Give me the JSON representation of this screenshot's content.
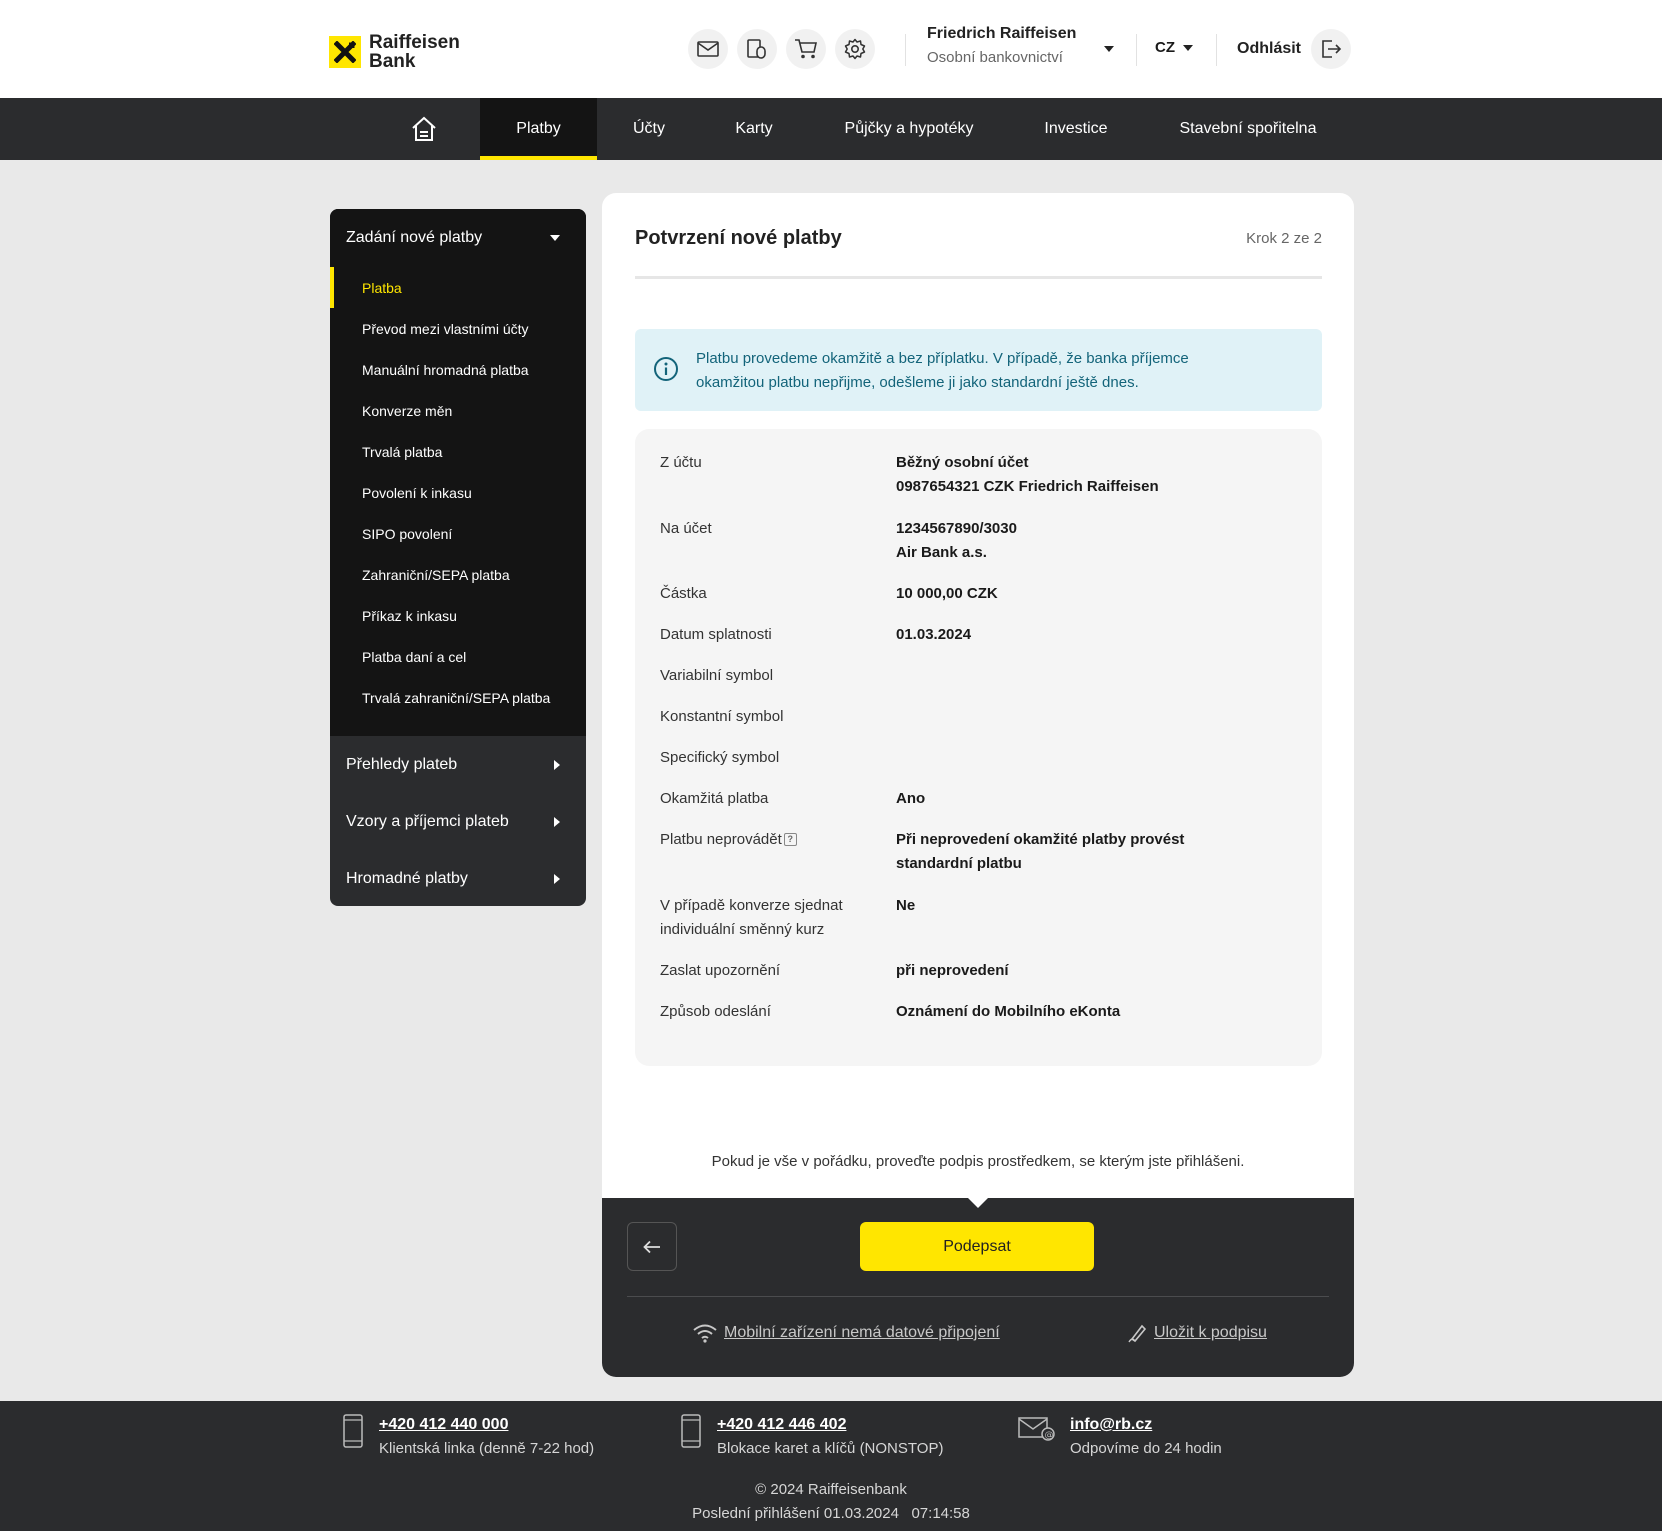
{
  "brand": {
    "logo_line1": "Raiffeisen",
    "logo_line2": "Bank",
    "accent_color": "#ffe600",
    "dark_color": "#2b2c2e"
  },
  "header": {
    "icons": [
      "mail-icon",
      "documents-icon",
      "cart-icon",
      "settings-icon"
    ],
    "user_name": "Friedrich Raiffeisen",
    "user_segment": "Osobní bankovnictví",
    "language": "CZ",
    "logout_label": "Odhlásit"
  },
  "nav": {
    "home_icon": "home-icon",
    "items": [
      "Platby",
      "Účty",
      "Karty",
      "Půjčky a hypotéky",
      "Investice",
      "Stavební spořitelna"
    ],
    "active": "Platby"
  },
  "sidebar": {
    "open_group": "Zadání nové platby",
    "sub_items": [
      "Platba",
      "Převod mezi vlastními účty",
      "Manuální hromadná platba",
      "Konverze měn",
      "Trvalá platba",
      "Povolení k inkasu",
      "SIPO povolení",
      "Zahraniční/SEPA platba",
      "Příkaz k inkasu",
      "Platba daní a cel",
      "Trvalá zahraniční/SEPA platba"
    ],
    "active_sub_item": "Platba",
    "groups": [
      "Přehledy plateb",
      "Vzory a příjemci plateb",
      "Hromadné platby"
    ]
  },
  "main": {
    "title": "Potvrzení nové platby",
    "step": "Krok 2 ze 2",
    "info_line1": "Platbu provedeme okamžitě a bez příplatku. V případě, že banka příjemce",
    "info_line2": "okamžitou platbu nepřijme, odešleme ji jako standardní ještě dnes.",
    "rows": [
      {
        "label": "Z účtu",
        "value_line1": "Běžný osobní účet",
        "value_line2": "0987654321  CZK Friedrich Raiffeisen"
      },
      {
        "label": "Na účet",
        "value_line1": "1234567890/3030",
        "value_line2": "Air Bank a.s."
      },
      {
        "label": "Částka",
        "value_line1": "10 000,00 CZK"
      },
      {
        "label": "Datum splatnosti",
        "value_line1": "01.03.2024"
      },
      {
        "label": "Variabilní symbol",
        "value_line1": ""
      },
      {
        "label": "Konstantní symbol",
        "value_line1": ""
      },
      {
        "label": "Specifický symbol",
        "value_line1": ""
      },
      {
        "label": "Okamžitá platba",
        "value_line1": "Ano"
      },
      {
        "label": "Platbu neprovádět",
        "value_line1": "Při neprovedení okamžité platby provést",
        "value_line2": "standardní platbu"
      },
      {
        "label": "V případě konverze sjednat individuální směnný kurz",
        "value_line1": "Ne"
      },
      {
        "label": "Zaslat upozornění",
        "value_line1": "při neprovedení"
      },
      {
        "label": "Způsob odeslání",
        "value_line1": "Oznámení do Mobilního eKonta"
      }
    ],
    "help_mark": "?",
    "notice": "Pokud je vše v pořádku, proveďte podpis prostředkem, se kterým jste přihlášeni.",
    "sign_button": "Podepsat",
    "link_offline": "Mobilní zařízení nemá datové připojení",
    "link_save": "Uložit k podpisu"
  },
  "footer": {
    "contacts": [
      {
        "icon": "phone-icon",
        "line1": "+420 412 440 000",
        "line2": "Klientská linka (denně 7-22 hod)"
      },
      {
        "icon": "phone-icon",
        "line1": "+420 412 446 402",
        "line2": "Blokace karet a klíčů (NONSTOP)"
      },
      {
        "icon": "email-icon",
        "line1": "info@rb.cz",
        "line2": "Odpovíme do 24 hodin"
      }
    ],
    "copyright": "© 2024 Raiffeisenbank",
    "last_login": "Poslední přihlášení 01.03.2024   07:14:58"
  }
}
